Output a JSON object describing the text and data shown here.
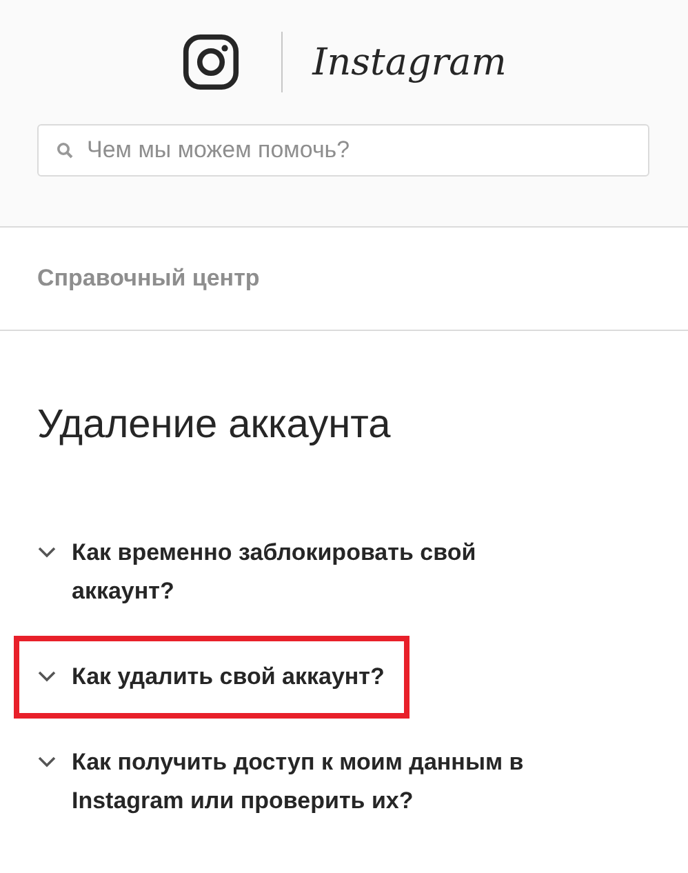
{
  "header": {
    "logo_text": "Instagram",
    "search": {
      "placeholder": "Чем мы можем помочь?"
    }
  },
  "breadcrumb": "Справочный центр",
  "heading": "Удаление аккаунта",
  "questions": [
    {
      "text": "Как временно заблокировать свой аккаунт?",
      "expanded": false,
      "highlighted": false
    },
    {
      "text": "Как удалить свой аккаунт?",
      "expanded": false,
      "highlighted": true
    },
    {
      "text": "Как получить доступ к моим данным в Instagram или проверить их?",
      "expanded": false,
      "highlighted": false
    }
  ]
}
